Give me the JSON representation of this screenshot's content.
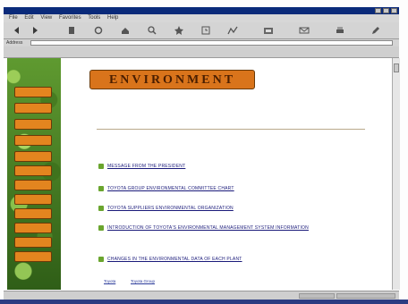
{
  "browser": {
    "menu": [
      "File",
      "Edit",
      "View",
      "Favorites",
      "Tools",
      "Help"
    ],
    "toolbar_icons": [
      "back-icon",
      "forward-icon",
      "stop-icon",
      "refresh-icon",
      "home-icon",
      "search-icon",
      "favorites-icon",
      "history-icon",
      "channels-icon",
      "fullscreen-icon",
      "mail-icon",
      "print-icon",
      "edit-icon"
    ],
    "address_label": "Address"
  },
  "sidebar": {
    "buttons": [
      "",
      "",
      "",
      "",
      "",
      "",
      "",
      "",
      "",
      "",
      "",
      ""
    ]
  },
  "page": {
    "banner": "ENVIRONMENT",
    "items": [
      {
        "label": "MESSAGE FROM THE PRESIDENT"
      },
      {
        "label": "TOYOTA GROUP ENVIRONMENTAL COMMITTEE CHART"
      },
      {
        "label": "TOYOTA SUPPLIERS ENVIRONMENTAL ORGANIZATION"
      },
      {
        "label": "INTRODUCTION OF TOYOTA'S ENVIRONMENTAL MANAGEMENT SYSTEM INFORMATION"
      },
      {
        "label": "CHANGES IN THE ENVIRONMENTAL DATA OF EACH PLANT"
      }
    ],
    "footer_links": [
      "Toyota",
      "Toyota Group",
      "",
      "",
      "",
      ""
    ]
  }
}
